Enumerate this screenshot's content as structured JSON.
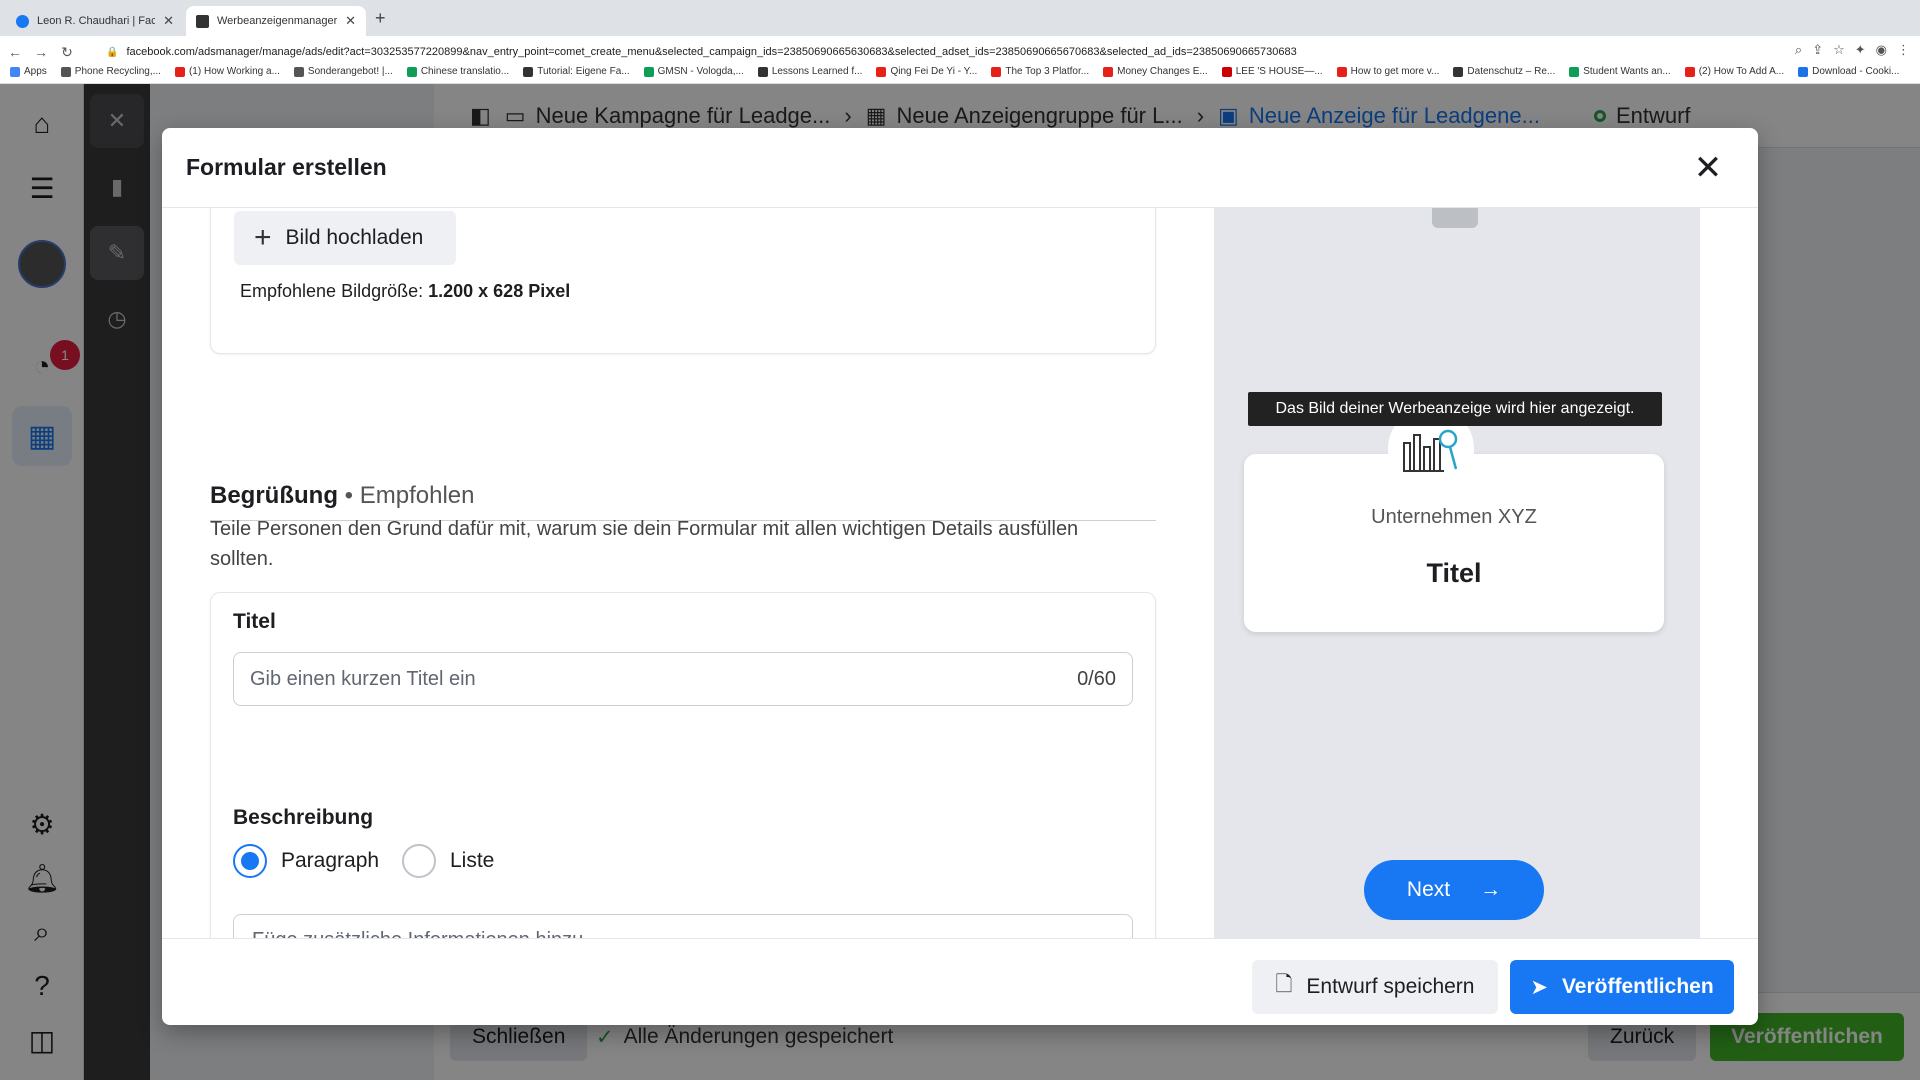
{
  "browser": {
    "tabs": [
      {
        "title": "Leon R. Chaudhari | Facebook",
        "active": false
      },
      {
        "title": "Werbeanzeigenmanager - Wer",
        "active": true
      }
    ],
    "url": "facebook.com/adsmanager/manage/ads/edit?act=303253577220899&nav_entry_point=comet_create_menu&selected_campaign_ids=23850690665630683&selected_adset_ids=23850690665670683&selected_ad_ids=23850690665730683",
    "bookmarks": [
      "Apps",
      "Phone Recycling,...",
      "(1) How Working a...",
      "Sonderangebot! |...",
      "Chinese translatio...",
      "Tutorial: Eigene Fa...",
      "GMSN - Vologda,...",
      "Lessons Learned f...",
      "Qing Fei De Yi - Y...",
      "The Top 3 Platfor...",
      "Money Changes E...",
      "LEE 'S HOUSE—...",
      "How to get more v...",
      "Datenschutz – Re...",
      "Student Wants an...",
      "(2) How To Add A...",
      "Download - Cooki..."
    ]
  },
  "app": {
    "notification_count": "1",
    "breadcrumbs": [
      "Neue Kampagne für Leadge...",
      "Neue Anzeigengruppe für L...",
      "Neue Anzeige für Leadgene..."
    ],
    "status": "Entwurf",
    "bottom": {
      "close": "Schließen",
      "saved": "Alle Änderungen gespeichert",
      "back": "Zurück",
      "publish": "Veröffentlichen"
    }
  },
  "modal": {
    "title": "Formular erstellen",
    "upload_label": "Bild hochladen",
    "image_size_prefix": "Empfohlene Bildgröße: ",
    "image_size_value": "1.200 x 628 Pixel",
    "greeting_title": "Begrüßung",
    "greeting_sep": " • ",
    "greeting_recommended": "Empfohlen",
    "greeting_desc": "Teile Personen den Grund dafür mit, warum sie dein Formular mit allen wichtigen Details ausfüllen sollten.",
    "title_label": "Titel",
    "title_placeholder": "Gib einen kurzen Titel ein",
    "title_counter": "0/60",
    "description_label": "Beschreibung",
    "radio_paragraph": "Paragraph",
    "radio_list": "Liste",
    "textarea_placeholder": "Füge zusätzliche Informationen hinzu",
    "preview": {
      "tooltip": "Das Bild deiner Werbeanzeige wird hier angezeigt.",
      "company": "Unternehmen XYZ",
      "title": "Titel",
      "next": "Next"
    },
    "footer": {
      "save_draft": "Entwurf speichern",
      "publish": "Veröffentlichen"
    }
  },
  "colors": {
    "primary": "#1877f2",
    "badge": "#e41e3f",
    "success": "#31a24c",
    "publish_green": "#42b72a"
  }
}
